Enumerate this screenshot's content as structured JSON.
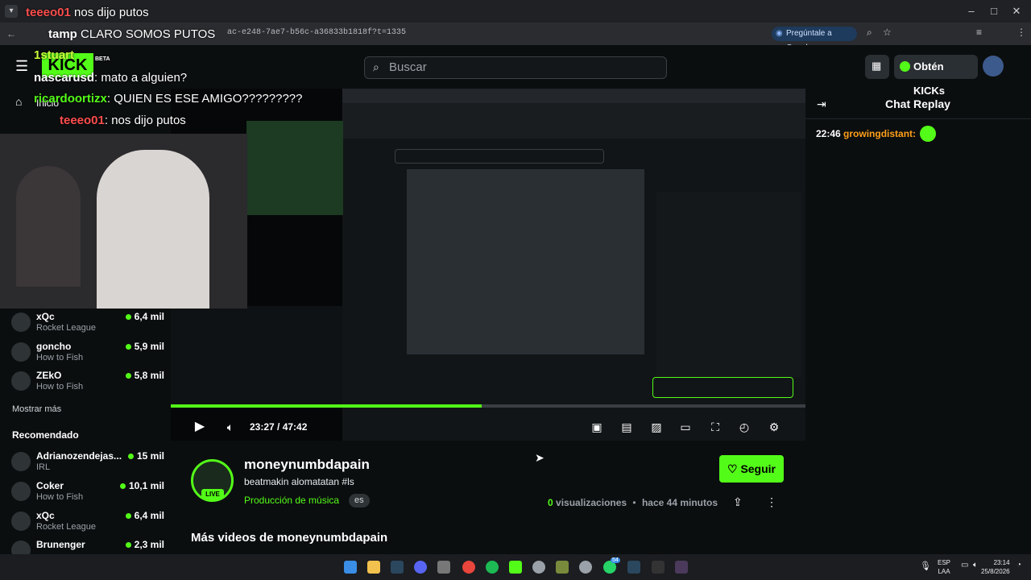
{
  "browser": {
    "url": "ac-e248-7ae7-b56c-a36833b1818f?t=1335",
    "ask_google": "Pregúntale a Google"
  },
  "header": {
    "search_placeholder": "Buscar",
    "get_kicks": "Obtén KICKs",
    "beta": "BETA"
  },
  "nav": {
    "home": "Inicio"
  },
  "overlay_chat": [
    {
      "user": "teeeo01",
      "text": "nos dijo putos",
      "color": "#ff4d4d"
    },
    {
      "user": "tamp",
      "text": "CLARO SOMOS PUTOS",
      "color": "#ffffff"
    },
    {
      "user": "1stuart",
      "text": "",
      "color": "#c9ff3a"
    },
    {
      "user": "nascarusd",
      "text": "mato a alguien?",
      "color": "#ffffff"
    },
    {
      "user": "ricardoortizx",
      "text": "QUIEN ES ESE AMIGO?????????",
      "color": "#53fc18"
    },
    {
      "user": "teeeo01",
      "text": "nos dijo putos",
      "color": "#ff4d4d"
    }
  ],
  "sidebar": {
    "following": [
      {
        "name": "xQc",
        "category": "Rocket League",
        "views": "6,4 mil"
      },
      {
        "name": "goncho",
        "category": "How to Fish",
        "views": "5,9 mil"
      },
      {
        "name": "ZEkO",
        "category": "How to Fish",
        "views": "5,8 mil"
      }
    ],
    "show_more": "Mostrar más",
    "recommended_title": "Recomendado",
    "recommended": [
      {
        "name": "Adrianozendejas...",
        "category": "IRL",
        "views": "15 mil"
      },
      {
        "name": "Coker",
        "category": "How to Fish",
        "views": "10,1 mil"
      },
      {
        "name": "xQc",
        "category": "Rocket League",
        "views": "6,4 mil"
      },
      {
        "name": "Brunenger",
        "category": "",
        "views": "2,3 mil"
      }
    ]
  },
  "player": {
    "time": "23:27 / 47:42",
    "progress": 0.49
  },
  "channel": {
    "name": "moneynumbdapain",
    "live": "LIVE",
    "title": "beatmakin alomatatan #ls",
    "category": "Producción de música",
    "language": "es",
    "follow": "Seguir",
    "views_count": "0",
    "views_label": "visualizaciones",
    "ago": "hace 44 minutos",
    "more_videos": "Más videos de moneynumbdapain"
  },
  "chat": {
    "title": "Chat Replay",
    "messages": [
      {
        "time": "22:46",
        "user": "growingdistant:",
        "color": "#ff9f1a"
      }
    ]
  },
  "taskbar": {
    "lang1": "ESP",
    "lang2": "LAA",
    "time": "23:14",
    "date": "25/8/2026",
    "badge": "54"
  },
  "colors": {
    "accent": "#53fc18",
    "bg": "#0b0e0f"
  }
}
